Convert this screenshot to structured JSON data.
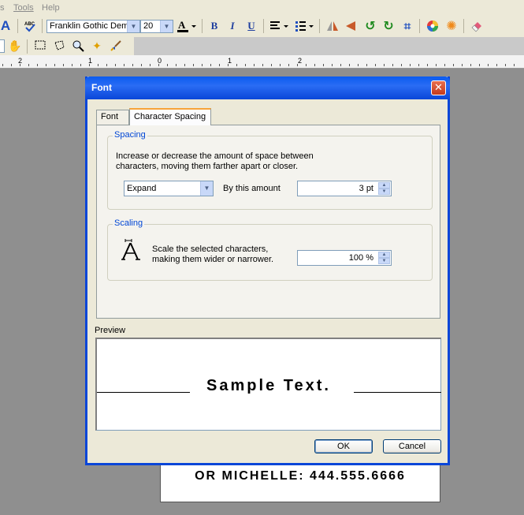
{
  "menu": {
    "items": [
      "s",
      "Tools",
      "Help"
    ]
  },
  "toolbar": {
    "font_name": "Franklin Gothic Dem",
    "font_size": "20",
    "bold": "B",
    "italic": "I",
    "underline": "U"
  },
  "ruler": {
    "numbers": [
      "2",
      "1",
      "0",
      "1",
      "2"
    ]
  },
  "document": {
    "text": "OR MICHELLE: 444.555.6666"
  },
  "dialog": {
    "title": "Font",
    "tabs": [
      {
        "label": "Font"
      },
      {
        "label": "Character Spacing"
      }
    ],
    "spacing": {
      "group_label": "Spacing",
      "description_line1": "Increase or decrease the amount of space between",
      "description_line2": "characters, moving them farther apart or closer.",
      "mode": "Expand",
      "by_label": "By this amount",
      "amount": "3  pt"
    },
    "scaling": {
      "group_label": "Scaling",
      "description_line1": "Scale the selected characters,",
      "description_line2": "making them wider or narrower.",
      "value": "100 %"
    },
    "preview_label": "Preview",
    "preview_text": "Sample Text.",
    "ok_label": "OK",
    "cancel_label": "Cancel"
  },
  "colors": {
    "title_bar": "#0a46d8",
    "tab_highlight": "#f7a43a",
    "group_label": "#0046d5",
    "close": "#c43a1c"
  }
}
